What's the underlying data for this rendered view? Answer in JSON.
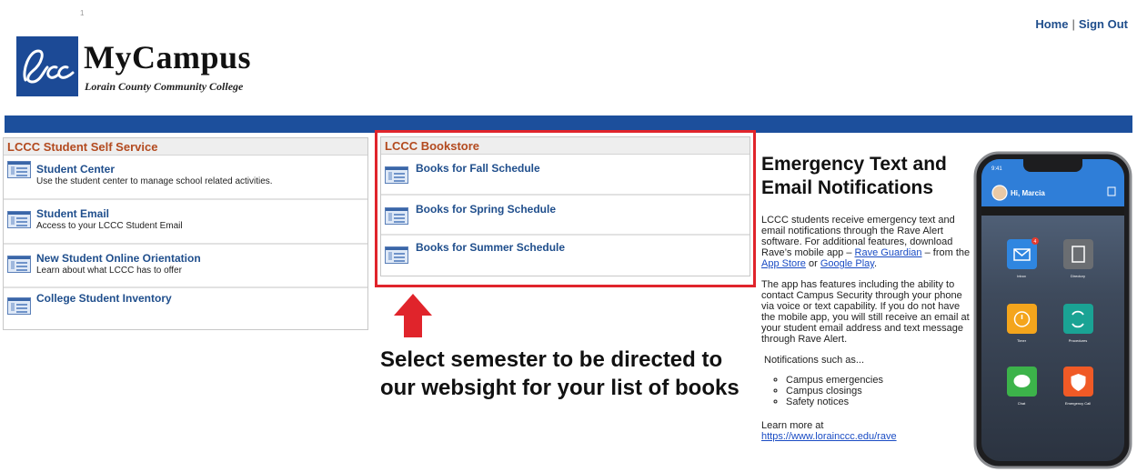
{
  "page": {
    "tiny_mark": "1"
  },
  "top_nav": {
    "home": "Home",
    "separator": "|",
    "sign_out": "Sign Out"
  },
  "logo": {
    "title": "MyCampus",
    "subtitle": "Lorain County Community College",
    "monogram": "Lccc"
  },
  "colors": {
    "brand_blue": "#1c4f9c",
    "portlet_header_text": "#b34a1f",
    "link_blue": "#1f4e8c",
    "highlight_red": "#e0242b"
  },
  "student_self_service": {
    "header": "LCCC Student Self Service",
    "items": [
      {
        "title": "Student Center",
        "desc": "Use the student center to manage school related activities.",
        "icon": "page-icon"
      },
      {
        "title": "Student Email",
        "desc": "Access to your LCCC Student Email",
        "icon": "page-icon"
      },
      {
        "title": "New Student Online Orientation",
        "desc": "Learn about what LCCC has to offer",
        "icon": "page-icon"
      },
      {
        "title": "College Student Inventory",
        "desc": "",
        "icon": "page-icon"
      }
    ]
  },
  "bookstore": {
    "header": "LCCC Bookstore",
    "items": [
      {
        "title": "Books for Fall Schedule",
        "icon": "page-icon"
      },
      {
        "title": "Books for Spring Schedule",
        "icon": "page-icon"
      },
      {
        "title": "Books for Summer Schedule",
        "icon": "page-icon"
      }
    ]
  },
  "annotation": {
    "text": "Select semester to be directed to our websight for your list of books",
    "arrow_icon": "up-arrow-icon"
  },
  "rave": {
    "heading": "Emergency Text and Email Notifications",
    "p1_before": "LCCC students receive emergency text and email notifications through the Rave Alert software. For additional features, download Rave’s mobile app – ",
    "p1_link_guardian": "Rave Guardian",
    "p1_mid": " – from the ",
    "p1_link_appstore": "App Store",
    "p1_or": " or ",
    "p1_link_googleplay": "Google Play",
    "p1_end": ".",
    "p2": "The app has features including the ability to contact Campus Security through your phone via voice or text capability. If you do not have the mobile app, you will still receive an email at your student email address and text message through Rave Alert.",
    "p3": "Notifications such as...",
    "bullets": [
      "Campus emergencies",
      "Campus closings",
      "Safety notices"
    ],
    "learn_more": "Learn more at",
    "learn_more_link": "https://www.lorainccc.edu/rave"
  },
  "phone": {
    "time": "9:41",
    "greeting": "Hi, Marcia",
    "badge_count": "4",
    "apps": [
      {
        "label": "Inbox",
        "icon": "mail-icon",
        "color": "#2f86e0"
      },
      {
        "label": "Directory",
        "icon": "directory-icon",
        "color": "#6b6e72"
      },
      {
        "label": "Timer",
        "icon": "timer-icon",
        "color": "#f4a51c"
      },
      {
        "label": "Procedures",
        "icon": "procedures-icon",
        "color": "#1aa394"
      },
      {
        "label": "Chat",
        "icon": "chat-icon",
        "color": "#3cb34a"
      },
      {
        "label": "Emergency Call",
        "icon": "shield-icon",
        "color": "#f05a26"
      }
    ]
  }
}
